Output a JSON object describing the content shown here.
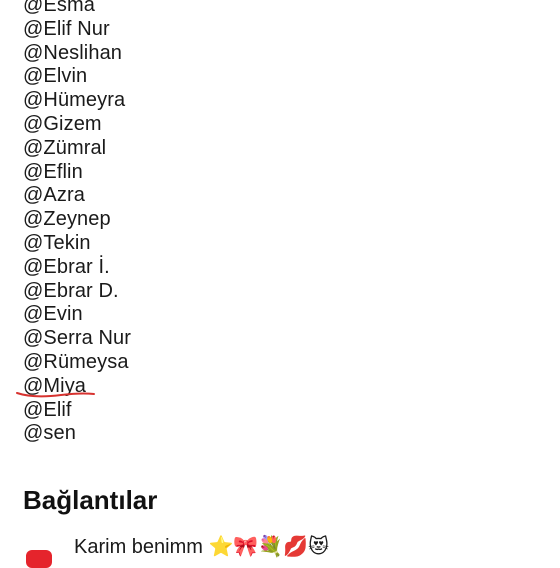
{
  "mentions": [
    "@Esma",
    "@Elif Nur",
    "@Neslihan",
    "@Elvin",
    "@Hümeyra",
    "@Gizem",
    "@Zümral",
    "@Eflin",
    "@Azra",
    "@Zeynep",
    "@Tekin",
    "@Ebrar İ.",
    "@Ebrar D.",
    "@Evin",
    "@Serra Nur",
    "@Rümeysa",
    "@Miya",
    "@Elif",
    "@sen"
  ],
  "underlined_mention": "@Miya",
  "annotation_color": "#d7322f",
  "links_section": {
    "title": "Bağlantılar",
    "items": [
      {
        "icon": "youtube-icon",
        "icon_color": "#e5242c",
        "label": "Karim benimm ⭐🎀💐💋😻"
      }
    ]
  }
}
